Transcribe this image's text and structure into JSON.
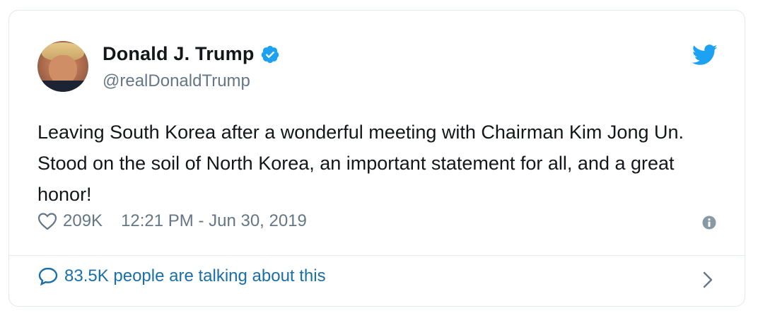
{
  "user": {
    "display_name": "Donald J. Trump",
    "handle": "@realDonaldTrump",
    "verified": true,
    "avatar_icon": "profile-photo"
  },
  "tweet": {
    "text": "Leaving South Korea after a wonderful meeting with Chairman Kim Jong Un. Stood on the soil of North Korea, an important statement for all, and a great honor!",
    "likes": "209K",
    "timestamp": "12:21 PM - Jun 30, 2019"
  },
  "footer": {
    "talking_text": "83.5K people are talking about this"
  },
  "colors": {
    "brand_blue": "#1da1f2",
    "link_blue": "#1b6fa8",
    "secondary_text": "#657786",
    "border": "#e1e8ed"
  }
}
